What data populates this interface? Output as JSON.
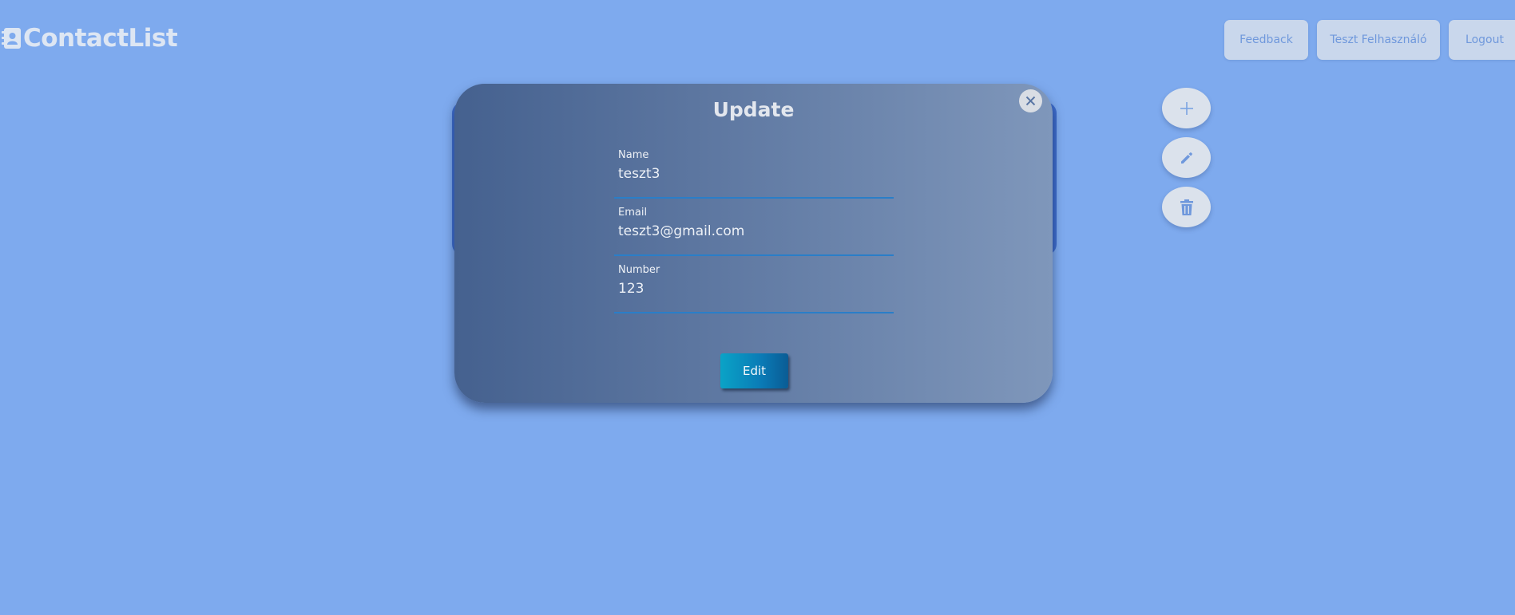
{
  "header": {
    "logo_text": "ContactList",
    "logo_icon": "address-book-icon",
    "nav": {
      "feedback": "Feedback",
      "user": "Teszt Felhasználó",
      "logout": "Logout"
    }
  },
  "actions": {
    "add_icon": "plus-icon",
    "edit_icon": "pencil-icon",
    "delete_icon": "trash-icon"
  },
  "modal": {
    "title": "Update",
    "close_icon": "close-icon",
    "fields": {
      "name": {
        "label": "Name",
        "value": "teszt3"
      },
      "email": {
        "label": "Email",
        "value": "teszt3@gmail.com"
      },
      "number": {
        "label": "Number",
        "value": "123"
      }
    },
    "submit_label": "Edit"
  },
  "colors": {
    "background": "#7eaaee",
    "accent": "#0a7bb6",
    "button_bg": "#c9d7ec",
    "button_text": "#6f98dc"
  }
}
